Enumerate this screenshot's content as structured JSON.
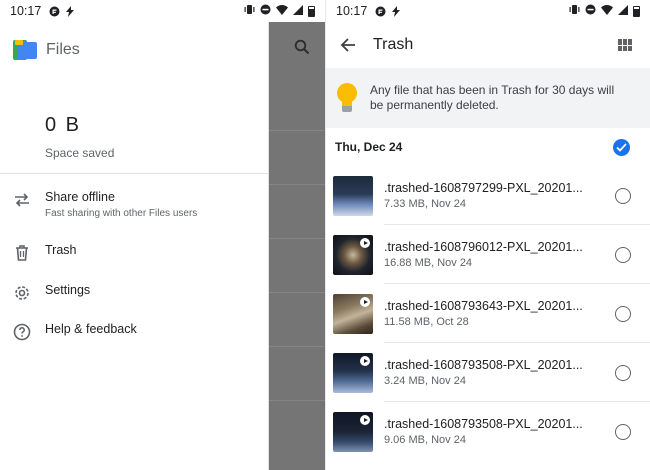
{
  "left": {
    "status": {
      "time": "10:17"
    },
    "drawer": {
      "title": "Files",
      "stat_value": "0 B",
      "stat_label": "Space saved",
      "items": [
        {
          "label": "Share offline",
          "sub": "Fast sharing with other Files users",
          "icon": "swap-arrows-icon"
        },
        {
          "label": "Trash",
          "icon": "trash-icon"
        },
        {
          "label": "Settings",
          "icon": "gear-icon"
        },
        {
          "label": "Help & feedback",
          "icon": "help-icon"
        }
      ]
    }
  },
  "right": {
    "status": {
      "time": "10:17"
    },
    "appbar": {
      "title": "Trash"
    },
    "banner": {
      "text": "Any file that has been in Trash for 30 days will be permanently deleted."
    },
    "section": {
      "date": "Thu, Dec 24"
    },
    "files": [
      {
        "name": ".trashed-1608797299-PXL_20201...",
        "meta": "7.33 MB, Nov 24",
        "video": false
      },
      {
        "name": ".trashed-1608796012-PXL_20201...",
        "meta": "16.88 MB, Nov 24",
        "video": true
      },
      {
        "name": ".trashed-1608793643-PXL_20201...",
        "meta": "11.58 MB, Oct 28",
        "video": true
      },
      {
        "name": ".trashed-1608793508-PXL_20201...",
        "meta": "3.24 MB, Nov 24",
        "video": true
      },
      {
        "name": ".trashed-1608793508-PXL_20201...",
        "meta": "9.06 MB, Nov 24",
        "video": true
      }
    ]
  },
  "colors": {
    "accent": "#1a73e8",
    "scrim": "#757575",
    "banner_bg": "#f1f3f4",
    "bulb": "#fbbc04"
  }
}
